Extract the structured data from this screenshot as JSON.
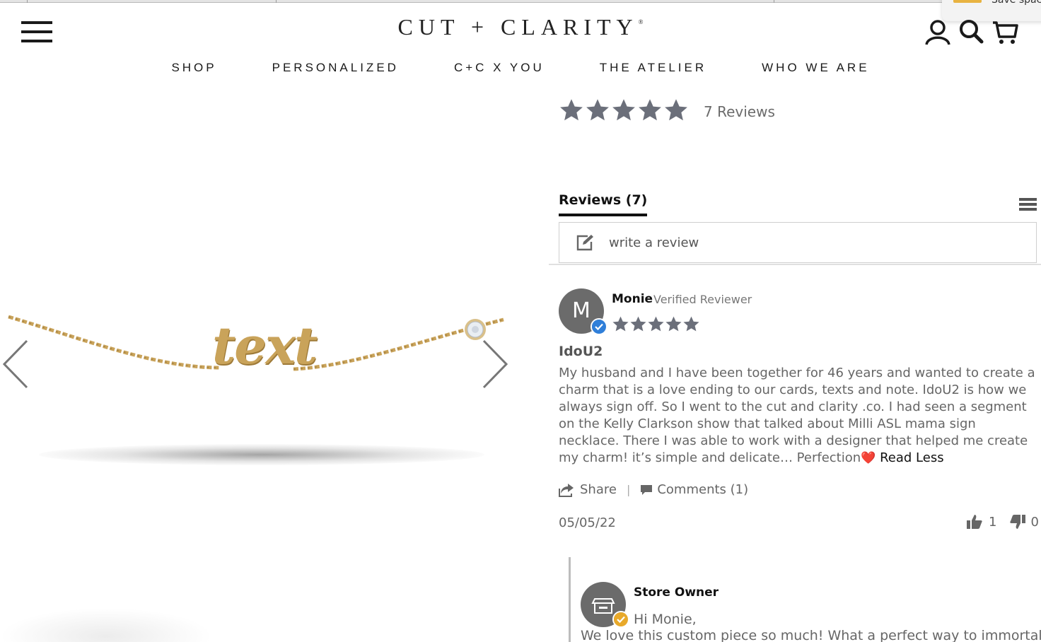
{
  "browser": {
    "popup_text": "Save spac"
  },
  "header": {
    "logo": "CUT + CLARITY",
    "logo_mark": "®",
    "nav": [
      "SHOP",
      "PERSONALIZED",
      "C+C X YOU",
      "THE ATELIER",
      "WHO WE ARE"
    ],
    "icons": [
      "menu-icon",
      "account-icon",
      "search-icon",
      "cart-icon"
    ]
  },
  "product": {
    "engraving_text": "text",
    "metal_color": "#c9a35a"
  },
  "summary": {
    "rating": 5,
    "star_color": "#6b6f7a",
    "reviews_link": "7 Reviews"
  },
  "reviews_widget": {
    "tab_label": "Reviews (7)",
    "write_review": "write a review"
  },
  "review": {
    "avatar_letter": "M",
    "name": "Monie",
    "badge": "Verified Reviewer",
    "stars": 5,
    "title": "IdoU2",
    "body": "My husband and I have been together for 46 years and wanted to create a charm that is a love ending to our cards, texts and note. IdoU2 is how we always sign off. So I went to the cut and clarity .co. I had seen a segment on the Kelly Clarkson show that talked about Milli ASL mama sign necklace. There I was able to work with a designer that helped me create my charm! it’s simple and delicate… Perfection",
    "emoji": "❤️",
    "read_less": "Read Less",
    "share": "Share",
    "separator": "|",
    "comments": "Comments (1)",
    "date": "05/05/22",
    "upvotes": "1",
    "downvotes": "0",
    "verified_color": "#2f7fd9"
  },
  "reply": {
    "name": "Store Owner",
    "greeting": "Hi Monie,",
    "body": "We love this custom piece so much! What a perfect way to immortalize",
    "badge_color": "#e8a92a"
  }
}
